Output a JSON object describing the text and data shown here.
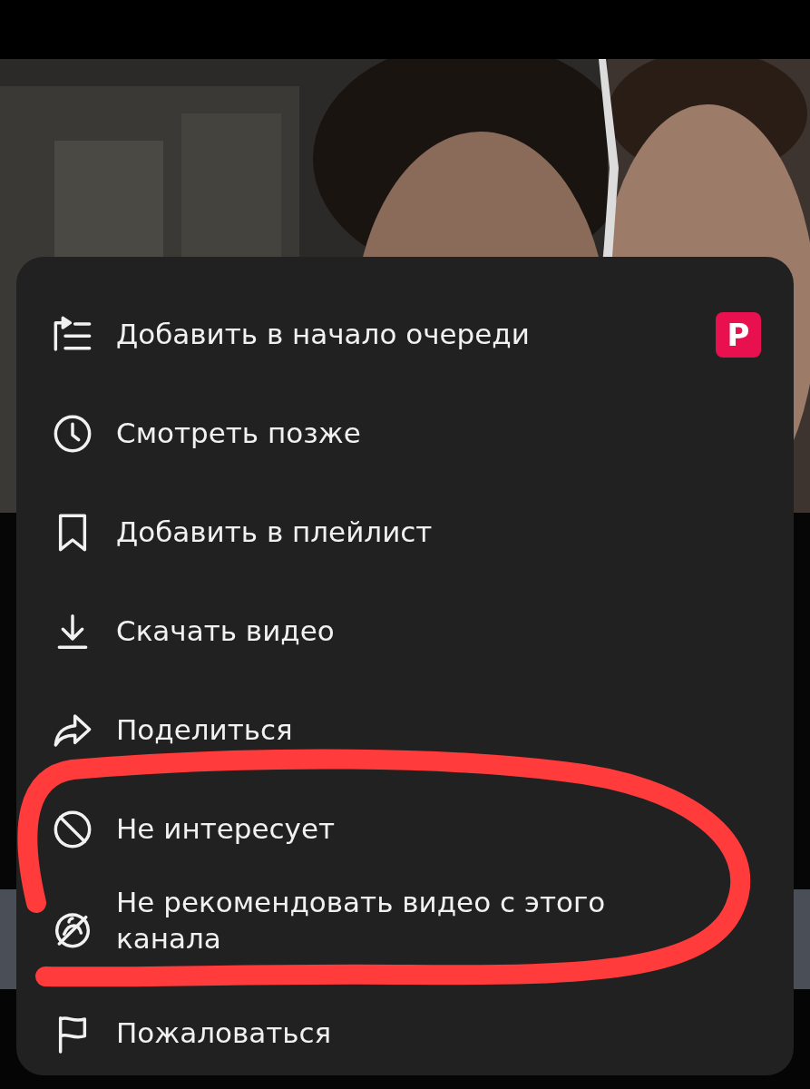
{
  "menu": {
    "items": [
      {
        "label": "Добавить в начало очереди",
        "badge": "P"
      },
      {
        "label": "Смотреть позже"
      },
      {
        "label": "Добавить в плейлист"
      },
      {
        "label": "Скачать видео"
      },
      {
        "label": "Поделиться"
      },
      {
        "label": "Не интересует"
      },
      {
        "label": "Не рекомендовать видео с этого канала"
      },
      {
        "label": "Пожаловаться"
      }
    ]
  },
  "annotation": {
    "kind": "outline",
    "color": "#ff3b3b"
  }
}
